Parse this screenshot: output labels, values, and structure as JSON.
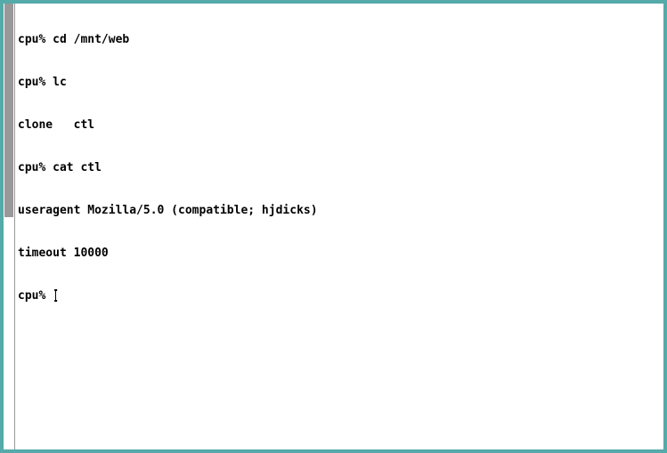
{
  "terminal": {
    "lines": [
      "cpu% cd /mnt/web",
      "cpu% lc",
      "clone   ctl",
      "cpu% cat ctl",
      "useragent Mozilla/5.0 (compatible; hjdicks)",
      "timeout 10000"
    ],
    "prompt": "cpu% "
  },
  "colors": {
    "border": "#55aaaa",
    "scroll_thumb": "#999999",
    "text": "#000000",
    "background": "#ffffff"
  }
}
